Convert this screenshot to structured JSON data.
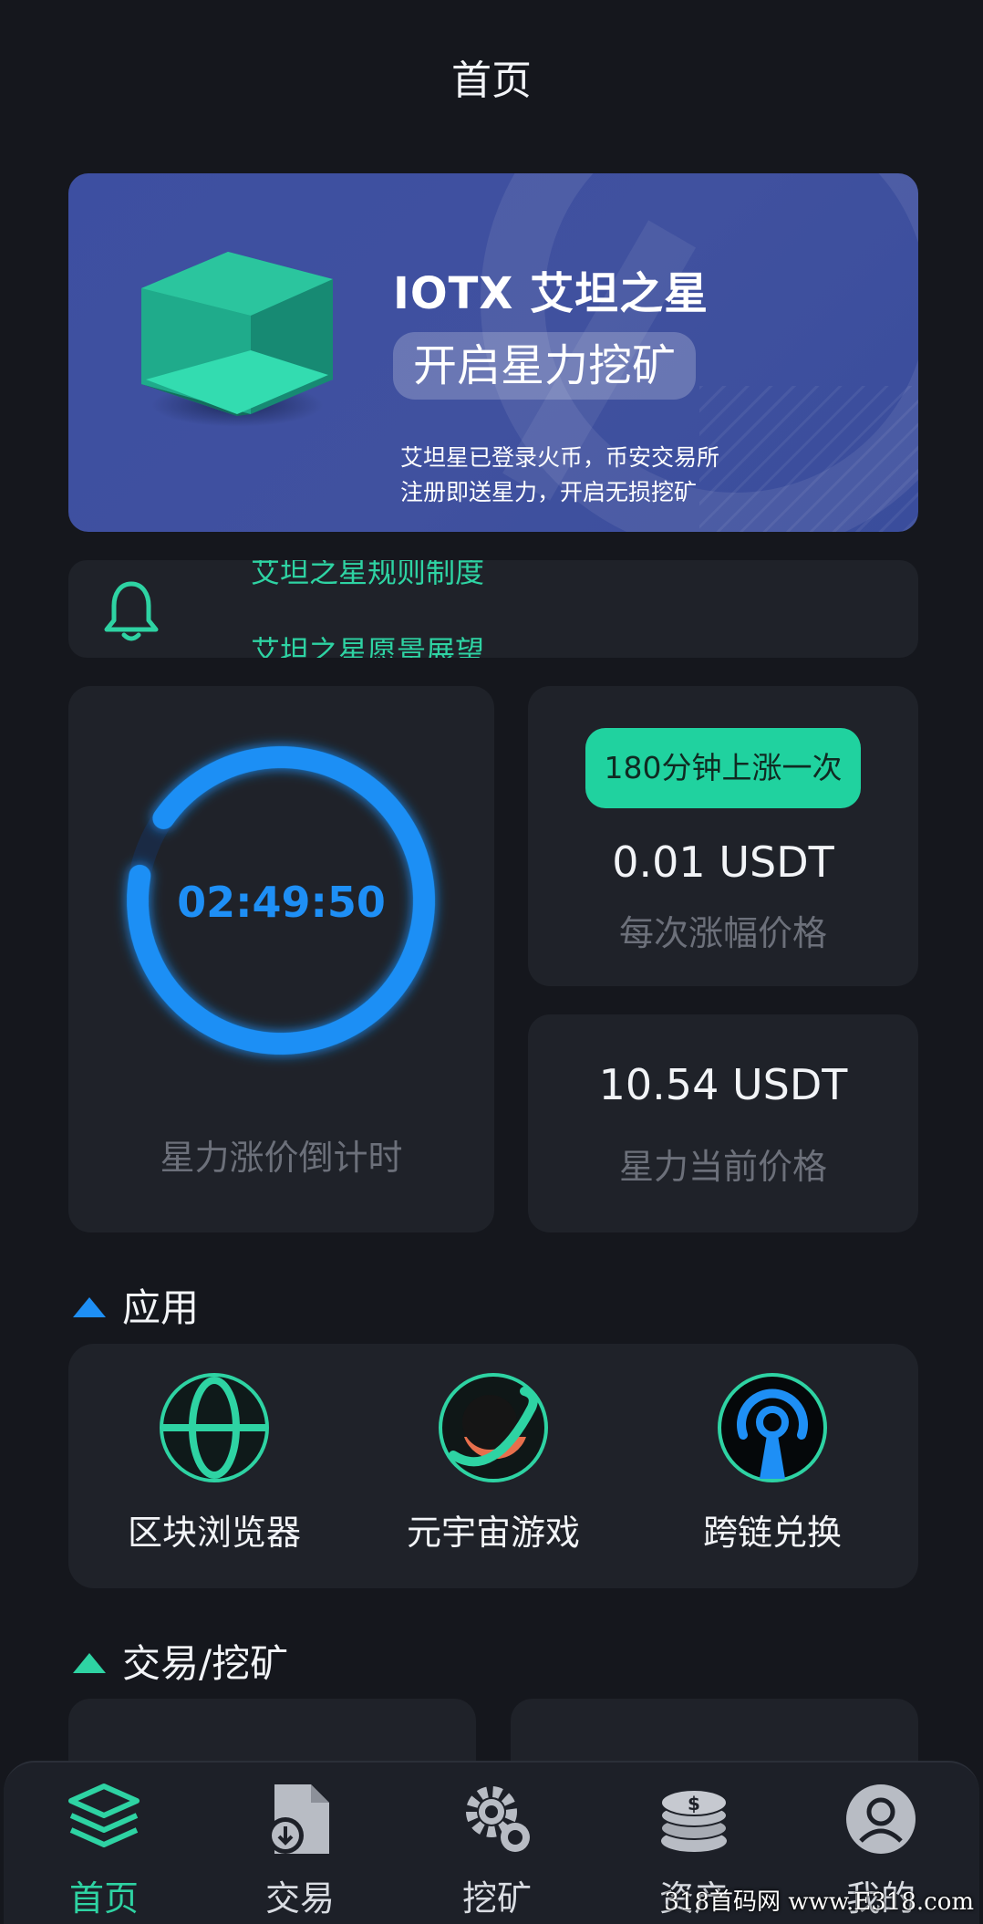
{
  "header": {
    "title": "首页"
  },
  "banner": {
    "title": "IOTX 艾坦之星",
    "pill": "开启星力挖矿",
    "subtitle_line1": "艾坦星已登录火币，币安交易所",
    "subtitle_line2": "注册即送星力，开启无损挖矿"
  },
  "notice": {
    "line1": "艾坦之星规则制度",
    "line2": "艾坦之星愿景展望"
  },
  "countdown": {
    "time": "02:49:50",
    "caption": "星力涨价倒计时",
    "progress_fraction": 0.93
  },
  "price_rise": {
    "interval_label": "180分钟上涨一次",
    "amount": "0.01 USDT",
    "caption": "每次涨幅价格"
  },
  "current_price": {
    "amount": "10.54 USDT",
    "caption": "星力当前价格"
  },
  "apps_section": {
    "title": "应用",
    "items": [
      {
        "label": "区块浏览器",
        "icon": "globe-icon"
      },
      {
        "label": "元宇宙游戏",
        "icon": "planet-icon"
      },
      {
        "label": "跨链兑换",
        "icon": "broadcast-icon"
      }
    ]
  },
  "trade_section": {
    "title": "交易/挖矿"
  },
  "tabbar": {
    "items": [
      {
        "label": "首页",
        "icon": "layers-icon",
        "active": true
      },
      {
        "label": "交易",
        "icon": "document-download-icon",
        "active": false
      },
      {
        "label": "挖矿",
        "icon": "gears-icon",
        "active": false
      },
      {
        "label": "资产",
        "icon": "coins-icon",
        "active": false
      },
      {
        "label": "我的",
        "icon": "user-icon",
        "active": false
      }
    ]
  },
  "watermark": "318首码网 www.E318.com",
  "colors": {
    "background": "#15171d",
    "card": "#1f2229",
    "accent_green": "#2ed3a3",
    "accent_blue": "#1e8ff5",
    "banner": "#3d4fa1"
  }
}
